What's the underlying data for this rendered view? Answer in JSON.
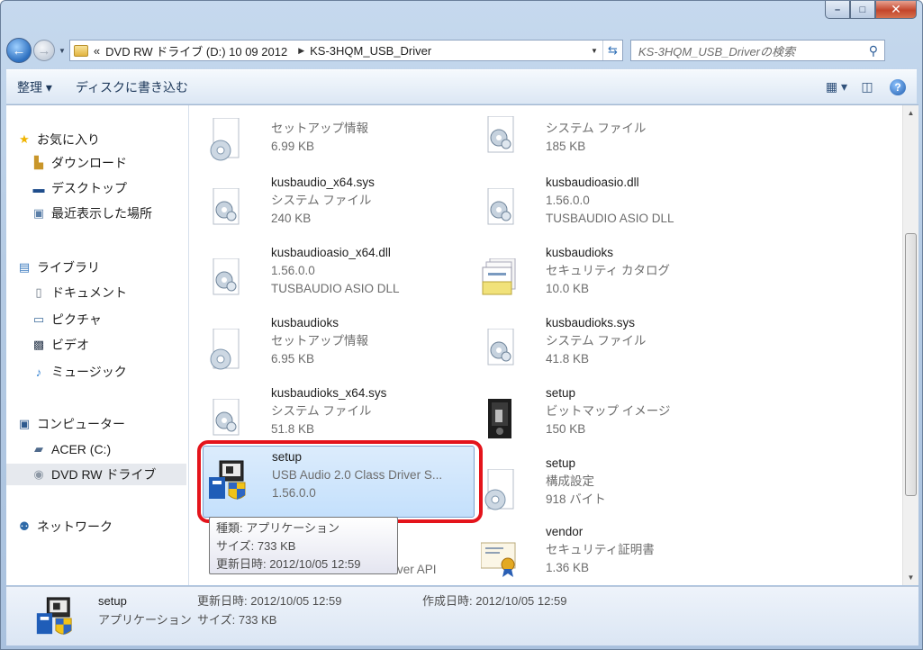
{
  "window": {
    "controls": {
      "minimize": "–",
      "maximize": "□",
      "close": "✕"
    }
  },
  "address": {
    "overflow": "«",
    "crumbs": [
      "DVD RW ドライブ (D:) 10 09 2012",
      "KS-3HQM_USB_Driver"
    ],
    "search_placeholder": "KS-3HQM_USB_Driverの検索"
  },
  "toolbar": {
    "organize": "整理 ▾",
    "burn": "ディスクに書き込む"
  },
  "nav": {
    "favorites": "お気に入り",
    "downloads": "ダウンロード",
    "desktop": "デスクトップ",
    "recent": "最近表示した場所",
    "libraries": "ライブラリ",
    "documents": "ドキュメント",
    "pictures": "ピクチャ",
    "videos": "ビデオ",
    "music": "ミュージック",
    "computer": "コンピューター",
    "acer": "ACER (C:)",
    "dvd": "DVD RW ドライブ",
    "network": "ネットワーク"
  },
  "files": [
    {
      "name": "",
      "type": "セットアップ情報",
      "size": "6.99 KB",
      "icon": "setup-info-icon"
    },
    {
      "name": "",
      "type": "システム ファイル",
      "size": "185 KB",
      "icon": "system-file-icon"
    },
    {
      "name": "kusbaudio_x64.sys",
      "type": "システム ファイル",
      "size": "240 KB",
      "icon": "system-file-icon"
    },
    {
      "name": "kusbaudioasio.dll",
      "type": "1.56.0.0",
      "size": "TUSBAUDIO ASIO DLL",
      "icon": "system-file-icon"
    },
    {
      "name": "kusbaudioasio_x64.dll",
      "type": "1.56.0.0",
      "size": "TUSBAUDIO ASIO DLL",
      "icon": "system-file-icon"
    },
    {
      "name": "kusbaudioks",
      "type": "セキュリティ カタログ",
      "size": "10.0 KB",
      "icon": "security-catalog-icon"
    },
    {
      "name": "kusbaudioks",
      "type": "セットアップ情報",
      "size": "6.95 KB",
      "icon": "setup-info-icon"
    },
    {
      "name": "kusbaudioks.sys",
      "type": "システム ファイル",
      "size": "41.8 KB",
      "icon": "system-file-icon"
    },
    {
      "name": "kusbaudioks_x64.sys",
      "type": "システム ファイル",
      "size": "51.8 KB",
      "icon": "system-file-icon"
    },
    {
      "name": "setup",
      "type": "ビットマップ イメージ",
      "size": "150 KB",
      "icon": "bitmap-image-icon"
    },
    {
      "name": "setup",
      "type": "USB Audio 2.0 Class Driver S...",
      "size": "1.56.0.0",
      "icon": "application-icon"
    },
    {
      "name": "setup",
      "type": "構成設定",
      "size": "918 バイト",
      "icon": "config-settings-icon"
    },
    {
      "name": "",
      "type": "",
      "size": "ver API",
      "icon": ""
    },
    {
      "name": "vendor",
      "type": "セキュリティ証明書",
      "size": "1.36 KB",
      "icon": "certificate-icon"
    }
  ],
  "tooltip": {
    "type": "種類: アプリケーション",
    "size": "サイズ: 733 KB",
    "modified": "更新日時: 2012/10/05 12:59"
  },
  "status": {
    "name": "setup",
    "type": "アプリケーション",
    "modified": "更新日時: 2012/10/05 12:59",
    "created": "作成日時: 2012/10/05 12:59",
    "size": "サイズ: 733 KB"
  },
  "colors": {
    "highlight": "#e4141b",
    "selection": "#c4e0fc",
    "frame": "#b5cbe4"
  }
}
